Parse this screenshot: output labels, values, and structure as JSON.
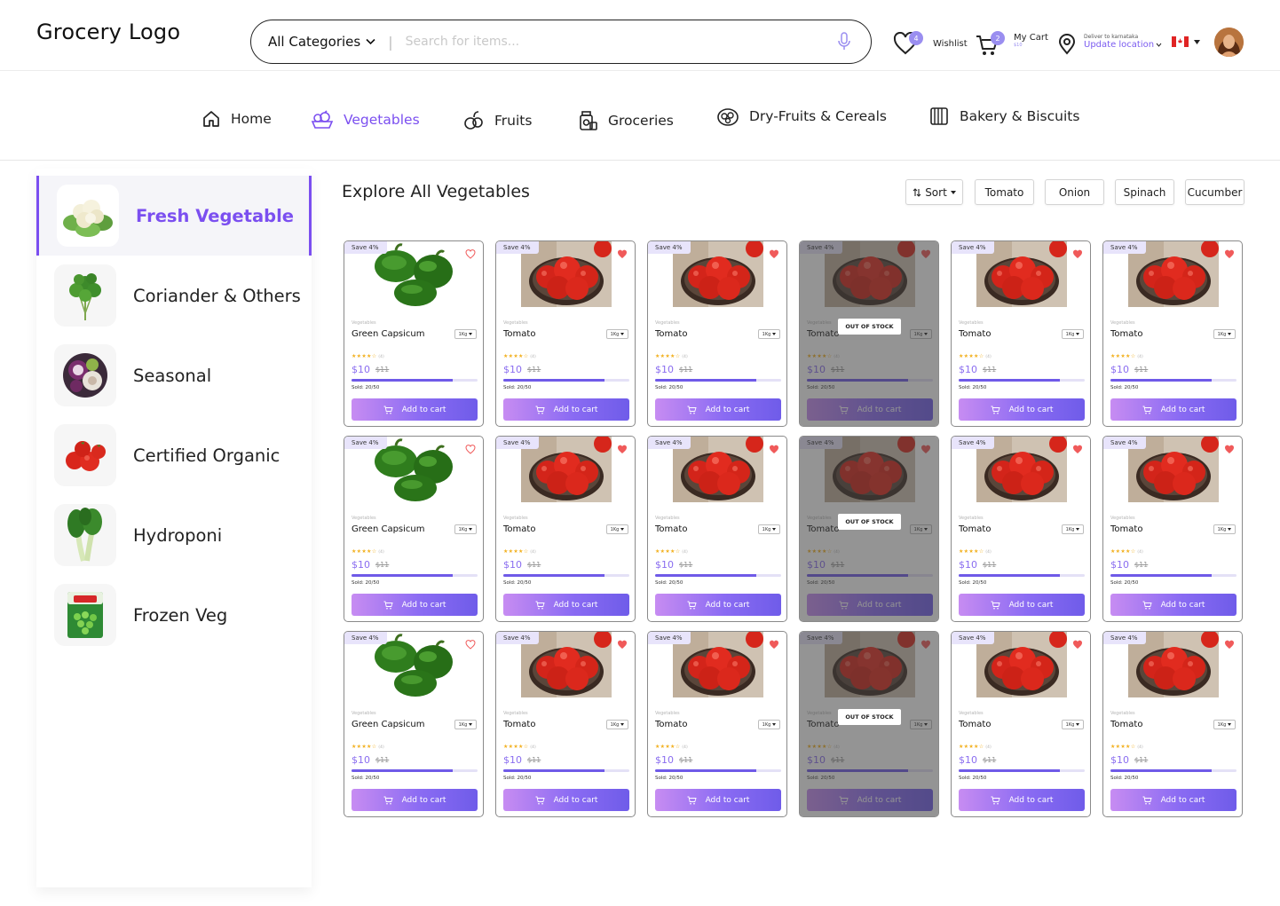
{
  "header": {
    "logo": "Grocery Logo",
    "category_select": "All Categories",
    "search_placeholder": "Search for items...",
    "wishlist": {
      "label": "Wishlist",
      "count": "4"
    },
    "cart": {
      "label": "My Cart",
      "amount": "$10",
      "count": "2"
    },
    "location": {
      "caption": "Deliver to karnataka",
      "link": "Update location"
    },
    "icons": {
      "wishlist": "heart-icon",
      "cart": "cart-icon",
      "location": "location-pin-icon",
      "mic": "mic-icon",
      "flag": "canada-flag-icon"
    }
  },
  "nav": {
    "items": [
      {
        "label": "Home",
        "icon": "home-icon",
        "active": false
      },
      {
        "label": "Vegetables",
        "icon": "vegetables-icon",
        "active": true
      },
      {
        "label": "Fruits",
        "icon": "fruits-icon",
        "active": false
      },
      {
        "label": "Groceries",
        "icon": "groceries-icon",
        "active": false
      },
      {
        "label": "Dry-Fruits & Cereals",
        "icon": "dry-fruits-icon",
        "active": false
      },
      {
        "label": "Bakery & Biscuits",
        "icon": "bakery-icon",
        "active": false
      }
    ]
  },
  "sidebar": {
    "items": [
      {
        "label": "Fresh Vegetable",
        "thumb": "cauliflower",
        "active": true
      },
      {
        "label": "Coriander & Others",
        "thumb": "coriander",
        "active": false
      },
      {
        "label": "Seasonal",
        "thumb": "seasonal",
        "active": false
      },
      {
        "label": "Certified Organic",
        "thumb": "tomatoes",
        "active": false
      },
      {
        "label": "Hydroponi",
        "thumb": "bokchoy",
        "active": false
      },
      {
        "label": "Frozen Veg",
        "thumb": "frozen-peas",
        "active": false
      }
    ]
  },
  "content": {
    "title": "Explore All Vegetables",
    "sort_label": "Sort",
    "filters": [
      "Tomato",
      "Onion",
      "Spinach",
      "Cucumber"
    ]
  },
  "common": {
    "save_badge": "Save 4%",
    "category": "Vegetables",
    "unit": "1Kg",
    "price": "$10",
    "old_price": "$11",
    "rating": 4,
    "reviews": "(4)",
    "sold_text": "Sold: 20/50",
    "sold_fraction": 0.8,
    "add_to_cart": "Add to cart",
    "out_of_stock": "OUT OF STOCK"
  },
  "products": [
    {
      "name": "Green Capsicum",
      "image": "capsicum",
      "wishlisted": false,
      "out_of_stock": false
    },
    {
      "name": "Tomato",
      "image": "tomato",
      "wishlisted": true,
      "out_of_stock": false
    },
    {
      "name": "Tomato",
      "image": "tomato",
      "wishlisted": true,
      "out_of_stock": false
    },
    {
      "name": "Tomato",
      "image": "tomato",
      "wishlisted": true,
      "out_of_stock": true
    },
    {
      "name": "Tomato",
      "image": "tomato",
      "wishlisted": true,
      "out_of_stock": false
    },
    {
      "name": "Tomato",
      "image": "tomato",
      "wishlisted": true,
      "out_of_stock": false
    },
    {
      "name": "Green Capsicum",
      "image": "capsicum",
      "wishlisted": false,
      "out_of_stock": false
    },
    {
      "name": "Tomato",
      "image": "tomato",
      "wishlisted": true,
      "out_of_stock": false
    },
    {
      "name": "Tomato",
      "image": "tomato",
      "wishlisted": true,
      "out_of_stock": false
    },
    {
      "name": "Tomato",
      "image": "tomato",
      "wishlisted": true,
      "out_of_stock": true
    },
    {
      "name": "Tomato",
      "image": "tomato",
      "wishlisted": true,
      "out_of_stock": false
    },
    {
      "name": "Tomato",
      "image": "tomato",
      "wishlisted": true,
      "out_of_stock": false
    },
    {
      "name": "Green Capsicum",
      "image": "capsicum",
      "wishlisted": false,
      "out_of_stock": false
    },
    {
      "name": "Tomato",
      "image": "tomato",
      "wishlisted": true,
      "out_of_stock": false
    },
    {
      "name": "Tomato",
      "image": "tomato",
      "wishlisted": true,
      "out_of_stock": false
    },
    {
      "name": "Tomato",
      "image": "tomato",
      "wishlisted": true,
      "out_of_stock": true
    },
    {
      "name": "Tomato",
      "image": "tomato",
      "wishlisted": true,
      "out_of_stock": false
    },
    {
      "name": "Tomato",
      "image": "tomato",
      "wishlisted": true,
      "out_of_stock": false
    }
  ],
  "colors": {
    "accent": "#7b4ff0",
    "price": "#8a6df0",
    "star": "#f2b01e",
    "heart_filled": "#f05a5a"
  }
}
